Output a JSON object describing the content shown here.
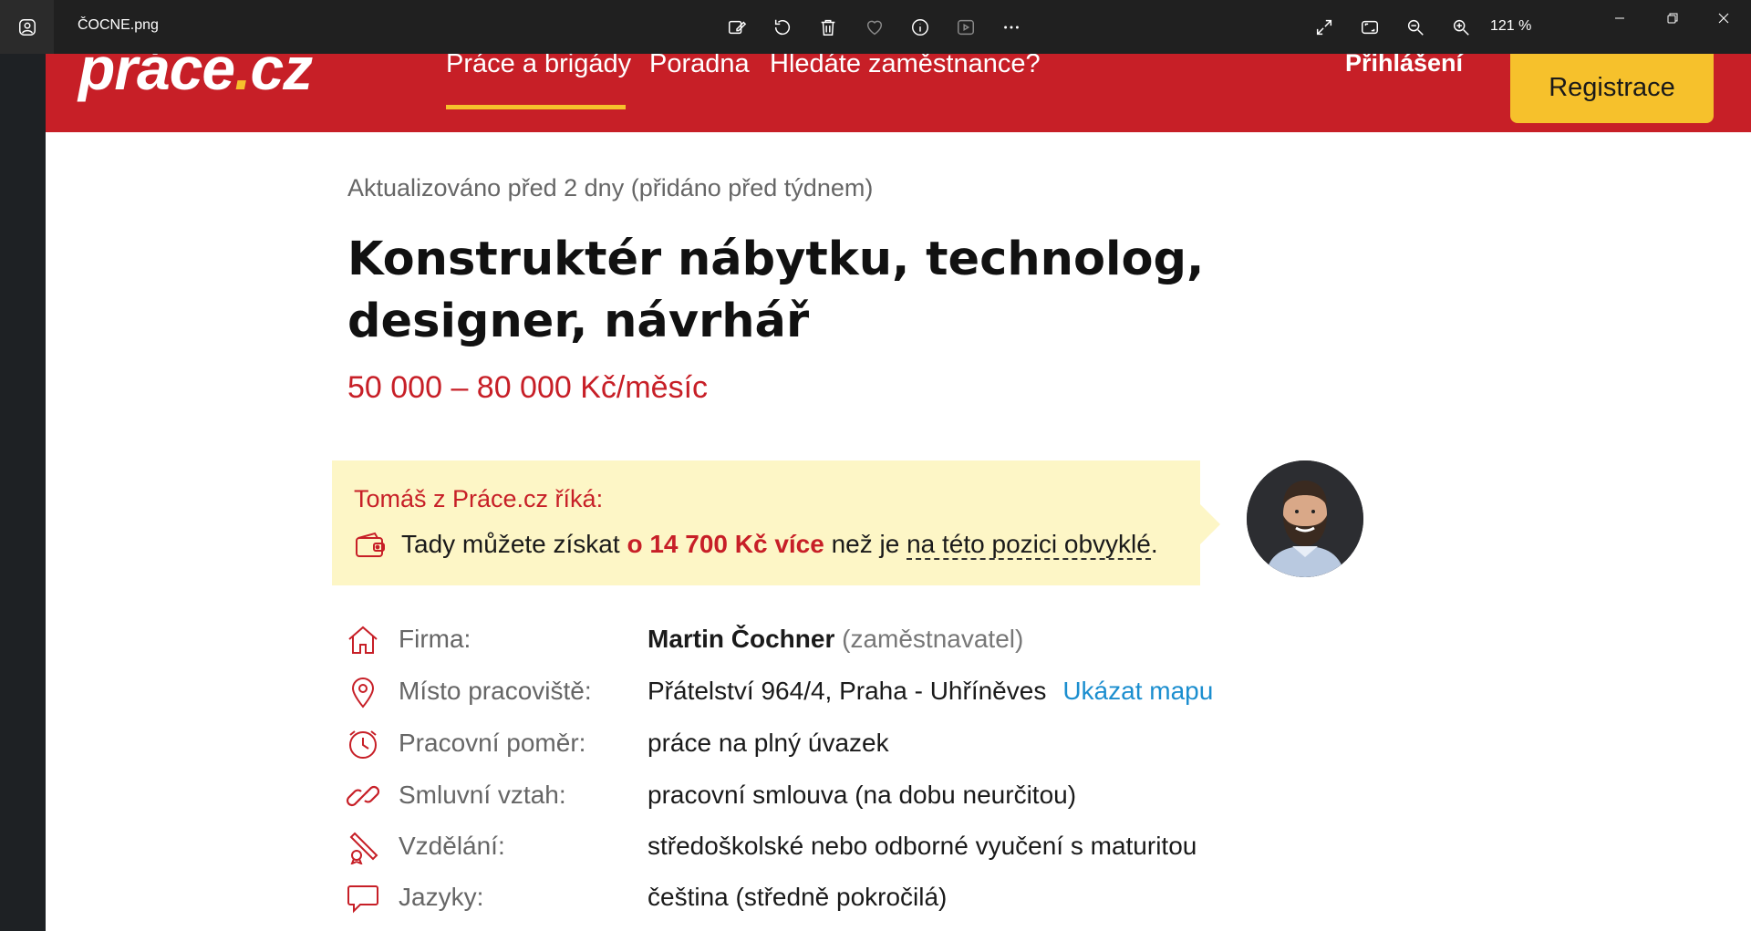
{
  "viewer": {
    "file_name": "ČOCNE.png",
    "zoom": "121 %",
    "toolbar_icons": [
      "edit-icon",
      "rotate-icon",
      "delete-icon",
      "favorite-icon",
      "info-icon",
      "slideshow-icon",
      "more-icon"
    ],
    "right_icons": [
      "fullscreen-icon",
      "fit-icon",
      "zoom-out-icon",
      "zoom-in-icon"
    ],
    "window_controls": [
      "minimize-icon",
      "maximize-icon",
      "close-icon"
    ]
  },
  "site": {
    "logo_main": "práce",
    "logo_dot": ".",
    "logo_tld": "cz",
    "nav": {
      "jobs": "Práce a brigády",
      "advice": "Poradna",
      "employers": "Hledáte zaměstnance?"
    },
    "login": "Přihlášení",
    "register": "Registrace",
    "brand_color": "#c71f27",
    "accent_color": "#f6c12c"
  },
  "job": {
    "updated": "Aktualizováno před 2 dny (přidáno před týdnem)",
    "title": "Konstruktér nábytku, technolog, designer, návrhář",
    "salary": "50 000 – 80 000 Kč/měsíc"
  },
  "tip": {
    "heading": "Tomáš z Práce.cz říká:",
    "text_before": "Tady můžete získat ",
    "amount": "o 14 700 Kč více",
    "text_middle": " než je ",
    "link": "na této pozici obvyklé",
    "text_end": "."
  },
  "details": {
    "company_label": "Firma:",
    "company_name": "Martin Čochner",
    "company_type": "(zaměstnavatel)",
    "location_label": "Místo pracoviště:",
    "location_value": "Přátelství 964/4, Praha - Uhříněves",
    "map_link": "Ukázat mapu",
    "employment_label": "Pracovní poměr:",
    "employment_value": "práce na plný úvazek",
    "contract_label": "Smluvní vztah:",
    "contract_value": "pracovní smlouva (na dobu neurčitou)",
    "education_label": "Vzdělání:",
    "education_value": "středoškolské nebo odborné vyučení s maturitou",
    "languages_label": "Jazyky:",
    "languages_value": "čeština (středně pokročilá)"
  }
}
